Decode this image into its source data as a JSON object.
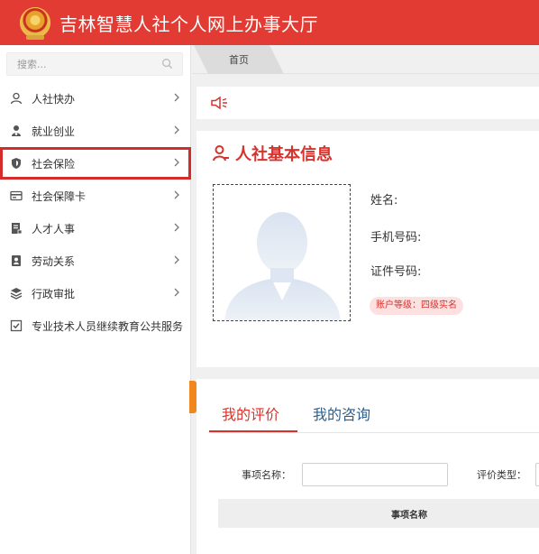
{
  "header": {
    "title": "吉林智慧人社个人网上办事大厅",
    "bg_color": "#e23b33",
    "emblem": "national-emblem"
  },
  "search": {
    "placeholder": "搜索..."
  },
  "sidebar": {
    "items": [
      {
        "label": "人社快办",
        "icon": "user-icon"
      },
      {
        "label": "就业创业",
        "icon": "employment-icon"
      },
      {
        "label": "社会保险",
        "icon": "shield-icon",
        "highlighted": true
      },
      {
        "label": "社会保障卡",
        "icon": "card-icon"
      },
      {
        "label": "人才人事",
        "icon": "document-icon"
      },
      {
        "label": "劳动关系",
        "icon": "id-badge-icon"
      },
      {
        "label": "行政审批",
        "icon": "layers-icon"
      },
      {
        "label": "专业技术人员继续教育公共服务",
        "icon": "checkbox-icon"
      }
    ]
  },
  "tabs": {
    "home_label": "首页"
  },
  "notice": {
    "icon": "speaker-icon"
  },
  "info": {
    "title": "人社基本信息",
    "name_label": "姓名:",
    "phone_label": "手机号码:",
    "id_label": "证件号码:",
    "account_level": "账户等级：四级实名"
  },
  "evaluation": {
    "tab_active": "我的评价",
    "tab_other": "我的咨询",
    "item_name_label": "事项名称：",
    "eval_type_label": "评价类型：",
    "column_header": "事项名称"
  },
  "colors": {
    "accent": "#d8322c",
    "handle": "#f0871f",
    "link": "#2f5f88"
  }
}
